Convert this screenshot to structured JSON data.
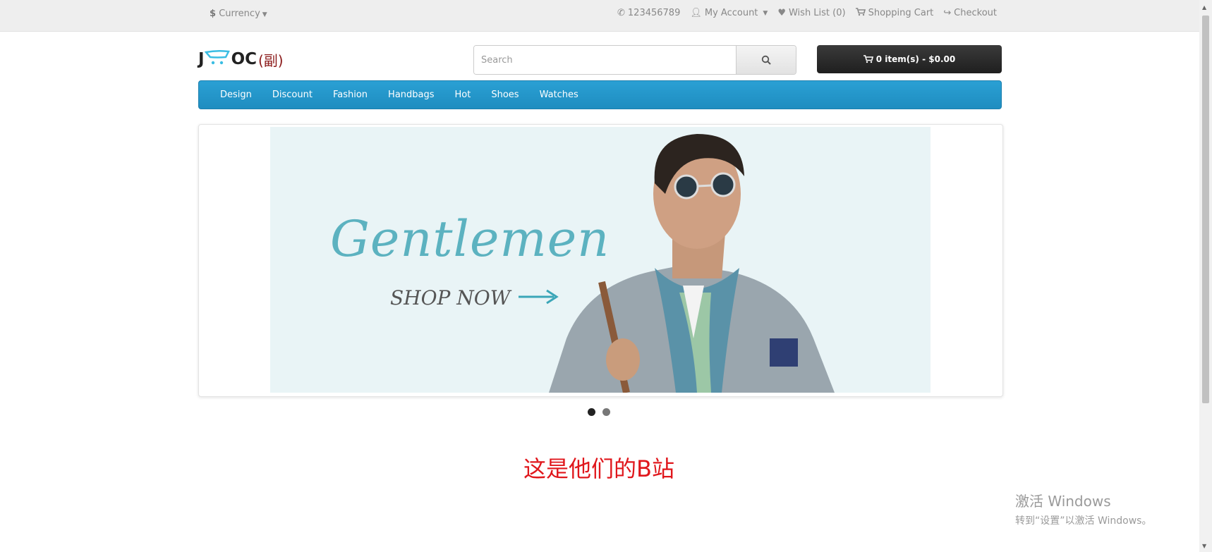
{
  "topbar": {
    "currency_symbol": "$",
    "currency_label": "Currency",
    "phone": "123456789",
    "account": "My Account",
    "wishlist": "Wish List (0)",
    "cart": "Shopping Cart",
    "checkout": "Checkout"
  },
  "header": {
    "logo_j": "J",
    "logo_oc": "OC",
    "logo_sub": "(副)",
    "search_placeholder": "Search",
    "cart_button": "0 item(s) - $0.00"
  },
  "nav": {
    "items": [
      "Design",
      "Discount",
      "Fashion",
      "Handbags",
      "Hot",
      "Shoes",
      "Watches"
    ]
  },
  "banner": {
    "headline": "Gentlemen",
    "cta": "SHOP NOW",
    "slides_total": 2,
    "active_slide": 1
  },
  "caption": "这是他们的B站",
  "watermark": {
    "line1": "激活 Windows",
    "line2": "转到“设置”以激活 Windows。"
  },
  "colors": {
    "nav": "#229ad0",
    "cart_button": "#2b2b2b",
    "caption": "#e0171c",
    "headline": "#5cb2c0"
  }
}
